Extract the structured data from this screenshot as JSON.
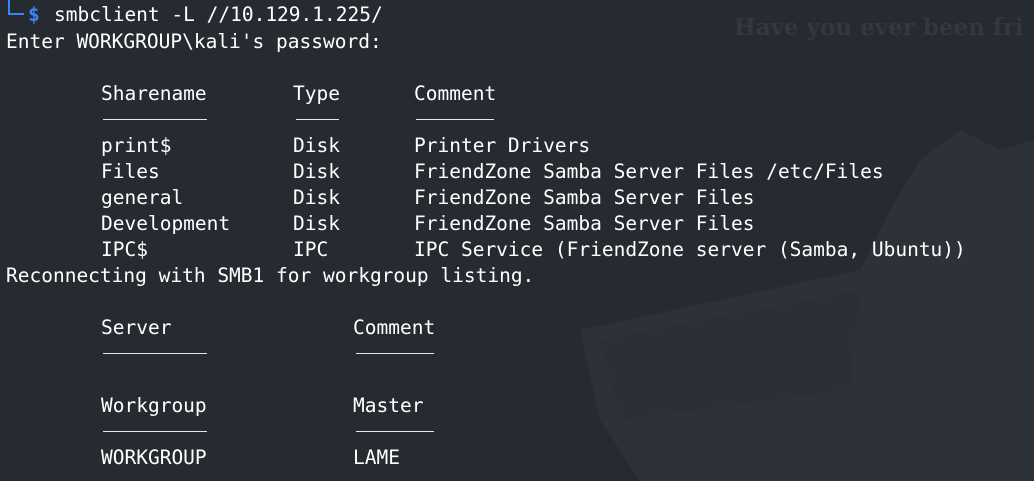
{
  "watermark": "Have you ever been fri",
  "prompt": {
    "symbol": "$",
    "command": "smbclient -L //10.129.1.225/"
  },
  "password_prompt": "Enter WORKGROUP\\kali's password:",
  "shares": {
    "headers": [
      "Sharename",
      "Type",
      "Comment"
    ],
    "rows": [
      [
        "print$",
        "Disk",
        "Printer Drivers"
      ],
      [
        "Files",
        "Disk",
        "FriendZone Samba Server Files /etc/Files"
      ],
      [
        "general",
        "Disk",
        "FriendZone Samba Server Files"
      ],
      [
        "Development",
        "Disk",
        "FriendZone Samba Server Files"
      ],
      [
        "IPC$",
        "IPC",
        "IPC Service (FriendZone server (Samba, Ubuntu))"
      ]
    ]
  },
  "reconnect_message": "Reconnecting with SMB1 for workgroup listing.",
  "servers": {
    "headers": [
      "Server",
      "Comment"
    ]
  },
  "workgroups": {
    "headers": [
      "Workgroup",
      "Master"
    ],
    "rows": [
      [
        "WORKGROUP",
        "LAME"
      ]
    ]
  },
  "colors": {
    "background": "#262b31",
    "prompt_accent": "#3b82f6",
    "text": "#ffffff"
  }
}
